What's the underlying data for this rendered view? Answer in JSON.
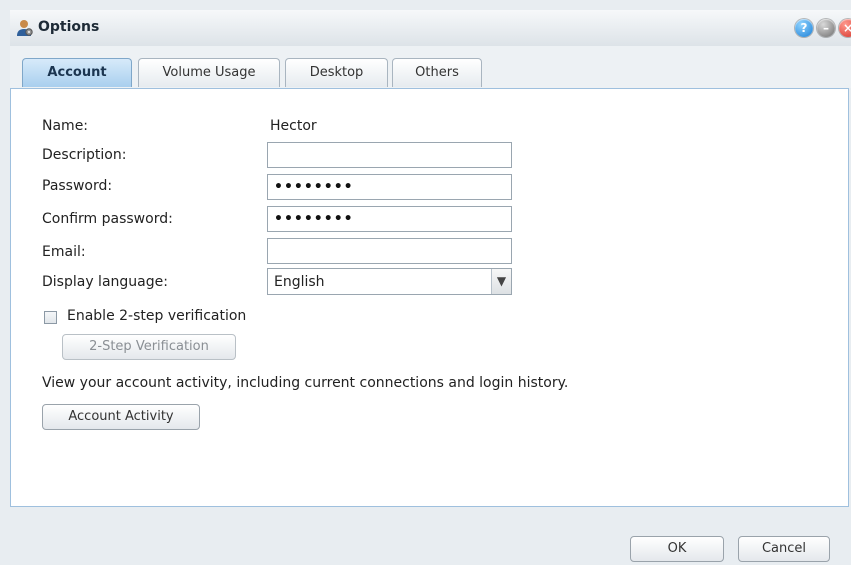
{
  "window": {
    "title": "Options"
  },
  "tabs": [
    {
      "label": "Account",
      "active": true
    },
    {
      "label": "Volume Usage",
      "active": false
    },
    {
      "label": "Desktop",
      "active": false
    },
    {
      "label": "Others",
      "active": false
    }
  ],
  "form": {
    "name_label": "Name:",
    "name_value": "Hector",
    "description_label": "Description:",
    "description_value": "",
    "password_label": "Password:",
    "password_value": "••••••••",
    "confirm_label": "Confirm password:",
    "confirm_value": "••••••••",
    "email_label": "Email:",
    "email_value": "",
    "language_label": "Display language:",
    "language_value": "English"
  },
  "two_step": {
    "checkbox_label": "Enable 2-step verification",
    "checked": false,
    "button_label": "2-Step Verification"
  },
  "activity": {
    "text": "View your account activity, including current connections and login history.",
    "button_label": "Account Activity"
  },
  "footer": {
    "ok_label": "OK",
    "cancel_label": "Cancel"
  },
  "icons": {
    "title": "user-options-icon",
    "help": "help-icon",
    "minimize": "minimize-icon",
    "close": "close-icon",
    "dropdown": "chevron-down-icon"
  },
  "colors": {
    "active_tab": "#a9cfee",
    "panel_border": "#9fc0de",
    "close": "#d5332a",
    "help": "#1b7fd6"
  }
}
